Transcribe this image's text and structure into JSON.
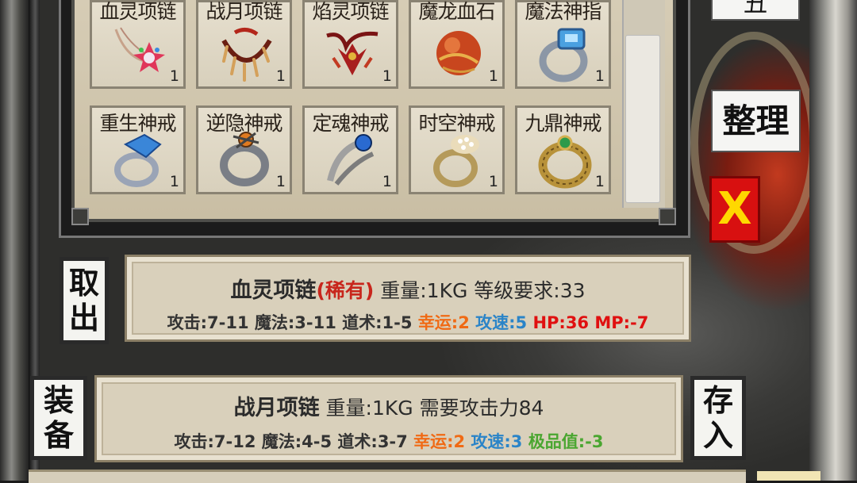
{
  "inventory": {
    "row1": [
      {
        "name": "血灵项链",
        "qty": "1",
        "icon": "necklace-icon",
        "color": "#d8437a"
      },
      {
        "name": "战月项链",
        "qty": "1",
        "icon": "claw-necklace-icon",
        "color": "#b3261a"
      },
      {
        "name": "焰灵项链",
        "qty": "1",
        "icon": "dragon-necklace-icon",
        "color": "#9c1d1d"
      },
      {
        "name": "魔龙血石",
        "qty": "1",
        "icon": "orb-icon",
        "color": "#c8461e"
      },
      {
        "name": "魔法神指",
        "qty": "1",
        "icon": "ring-icon",
        "color": "#5aa6d8"
      }
    ],
    "row2": [
      {
        "name": "重生神戒",
        "qty": "1",
        "icon": "ring-icon",
        "color": "#3a86d8"
      },
      {
        "name": "逆隐神戒",
        "qty": "1",
        "icon": "ring-icon",
        "color": "#e07a20"
      },
      {
        "name": "定魂神戒",
        "qty": "1",
        "icon": "ring-icon",
        "color": "#2a6ad0"
      },
      {
        "name": "时空神戒",
        "qty": "1",
        "icon": "ring-icon",
        "color": "#e9dcb8"
      },
      {
        "name": "九鼎神戒",
        "qty": "1",
        "icon": "ring-icon",
        "color": "#2c9a4a"
      }
    ]
  },
  "buttons": {
    "top_partial": "丑",
    "sort": "整理",
    "close": "X",
    "take_out": [
      "取",
      "出"
    ],
    "equip": [
      "装",
      "备"
    ],
    "store": [
      "存",
      "入"
    ]
  },
  "card1": {
    "name": "血灵项链",
    "rarity": "(稀有)",
    "meta": " 重量:1KG 等级要求:33",
    "stats_plain": "攻击:7-11 魔法:3-11 道术:1-5 ",
    "luck": "幸运:2",
    "speed": "攻速:5",
    "hp": "HP:36",
    "mp": "MP:-7"
  },
  "card2": {
    "name": "战月项链",
    "meta": " 重量:1KG 需要攻击力84",
    "stats_plain": "攻击:7-12 魔法:4-5 道术:3-7 ",
    "luck": "幸运:2",
    "speed": "攻速:3",
    "quality": "极品值:-3"
  },
  "colors": {
    "rare": "#c8261c",
    "luck": "#f06a14",
    "speed": "#2a84c8",
    "hp_mp": "#e01010",
    "quality": "#4aa630",
    "close_bg": "#d81010",
    "close_fg": "#ffd800"
  }
}
